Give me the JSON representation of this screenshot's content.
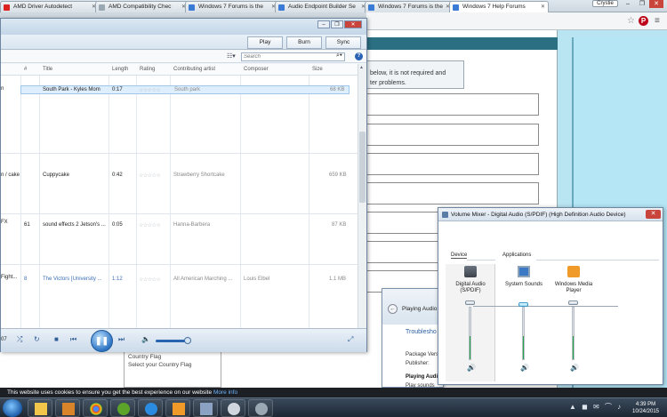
{
  "browser": {
    "tabs": [
      {
        "label": "AMD Driver Autodetect"
      },
      {
        "label": "AMD Compatibility Chec"
      },
      {
        "label": "Windows 7 Forums is the"
      },
      {
        "label": "Audio Endpoint Builder Se"
      },
      {
        "label": "Windows 7 Forums is the"
      },
      {
        "label": "Windows 7 Help Forums"
      }
    ],
    "profile": "Crystie"
  },
  "webpage": {
    "notice_line1": "below, it is not required and",
    "notice_line2": "ter problems.",
    "country_flag": "Country Flag",
    "select_country": "Select your Country Flag"
  },
  "wmp": {
    "tabs": {
      "play": "Play",
      "burn": "Burn",
      "sync": "Sync"
    },
    "search_placeholder": "Search",
    "columns": {
      "num": "#",
      "title": "Title",
      "length": "Length",
      "rating": "Rating",
      "artist": "Contributing artist",
      "composer": "Composer",
      "size": "Size"
    },
    "rows": [
      {
        "num": "",
        "title": "South Park - Kyles Mom",
        "length": "0:17",
        "artist": "South park",
        "composer": "",
        "size": "68 KB",
        "left": "n"
      },
      {
        "num": "",
        "title": "Cuppycake",
        "length": "0:42",
        "artist": "Strawberry Shortcake",
        "composer": "",
        "size": "659 KB",
        "left": "n / cake"
      },
      {
        "num": "61",
        "title": "sound effects 2 Jetson's ...",
        "length": "0:05",
        "artist": "Hanna-Barbera",
        "composer": "",
        "size": "87 KB",
        "left": "FX"
      },
      {
        "num": "8",
        "title": "The Victors [University ...",
        "length": "1:12",
        "artist": "All American Marching ...",
        "composer": "Louis Elbel",
        "size": "1.1 MB",
        "left": "Fight..."
      }
    ],
    "time": "07"
  },
  "troubleshooter": {
    "title": "Playing Audio",
    "heading": "Troublesho",
    "package": "Package Vers",
    "publisher": "Publisher:",
    "playing": "Playing Audi",
    "play_sounds": "Play sounds"
  },
  "mixer": {
    "title": "Volume Mixer - Digital Audio (S/PDIF) (High Definition Audio Device)",
    "device_label": "Device",
    "apps_label": "Applications",
    "channels": [
      {
        "name_line1": "Digital Audio",
        "name_line2": "(S/PDIF)",
        "level": 0.45
      },
      {
        "name_line1": "System Sounds",
        "name_line2": "",
        "level": 0.45
      },
      {
        "name_line1": "Windows Media",
        "name_line2": "Player",
        "level": 0.45
      }
    ]
  },
  "cookie": {
    "text": "This website uses cookies to ensure you get the best experience on our website",
    "link": "More info"
  },
  "taskbar": {
    "time": "4:39 PM",
    "date": "10/24/2015"
  }
}
